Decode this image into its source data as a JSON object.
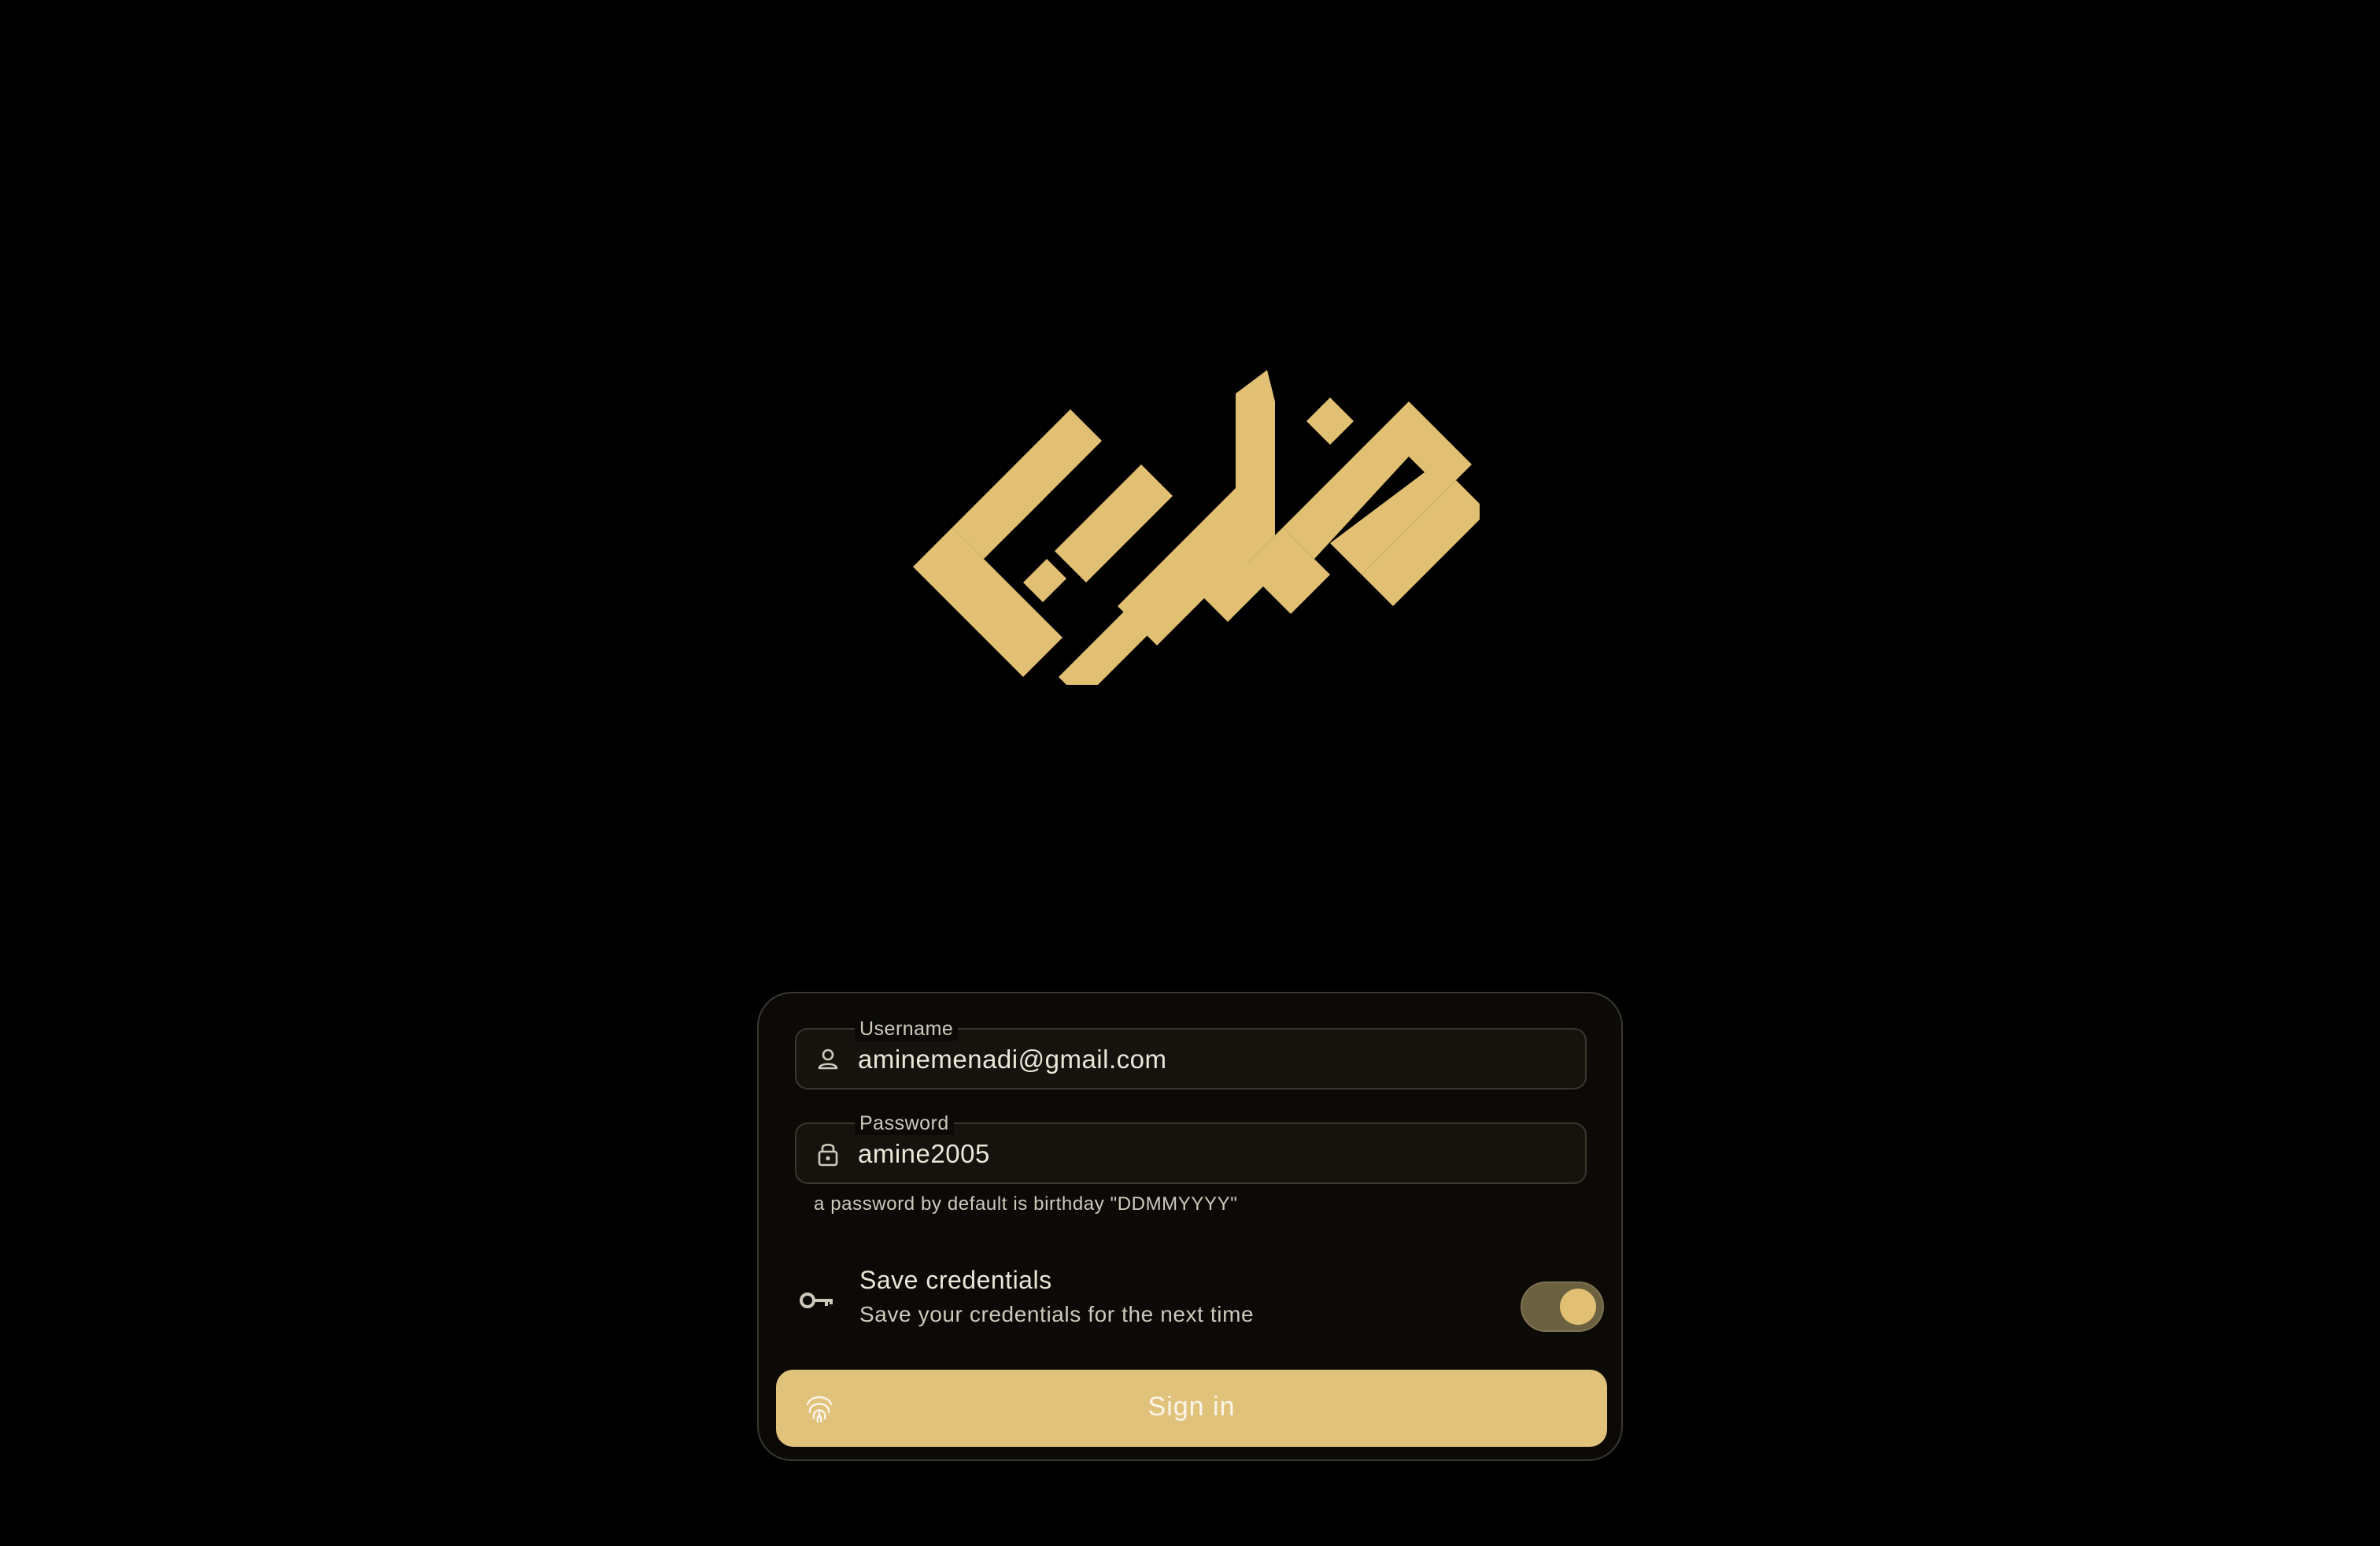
{
  "brand": {
    "logo_icon": "arabic-kufic-calligraphy-logo",
    "color": "#E1C074"
  },
  "login": {
    "username": {
      "label": "Username",
      "value": "aminemenadi@gmail.com",
      "icon": "person-icon"
    },
    "password": {
      "label": "Password",
      "value": "amine2005",
      "icon": "lock-icon",
      "hint": "a password by default is birthday \"DDMMYYYY\""
    },
    "save_credentials": {
      "title": "Save credentials",
      "subtitle": "Save your credentials for the next time",
      "icon": "key-icon",
      "enabled": true
    },
    "signin": {
      "label": "Sign in",
      "icon": "fingerprint-icon"
    }
  },
  "colors": {
    "background": "#000000",
    "card": "#0B0A07",
    "accent": "#E1C27B",
    "toggle_track": "#6B6040"
  }
}
